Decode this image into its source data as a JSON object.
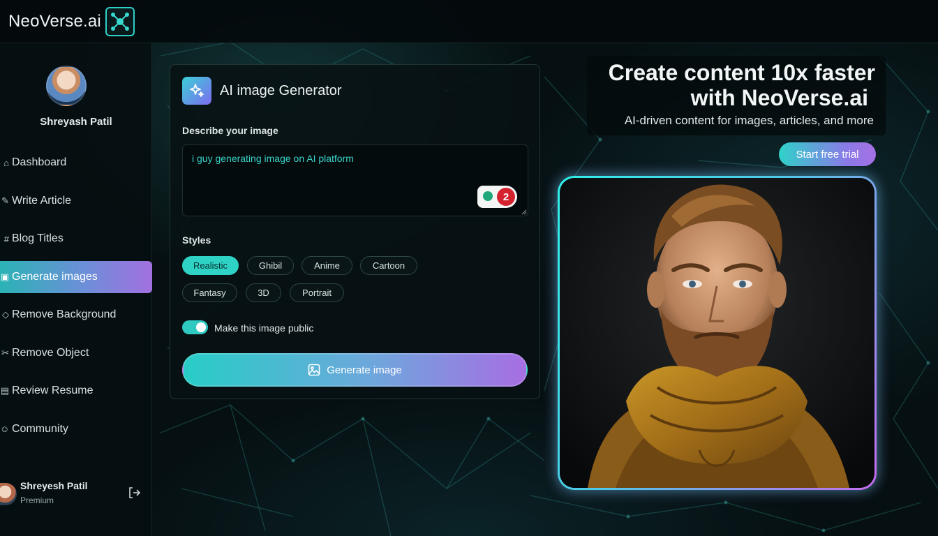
{
  "app": {
    "brand": "NeoVerse.ai",
    "logo_icon": "network-nodes-icon"
  },
  "user": {
    "name": "Shreyash Patil",
    "tier": "Premium"
  },
  "sidebar": {
    "items": [
      {
        "label": "Dashboard",
        "icon": "home-icon",
        "active": false
      },
      {
        "label": "Write Article",
        "icon": "pencil-icon",
        "active": false
      },
      {
        "label": "Blog Titles",
        "icon": "hash-icon",
        "active": false
      },
      {
        "label": "Generate images",
        "icon": "image-icon",
        "active": true
      },
      {
        "label": "Remove Background",
        "icon": "eraser-icon",
        "active": false
      },
      {
        "label": "Remove Object",
        "icon": "scissors-icon",
        "active": false
      },
      {
        "label": "Review Resume",
        "icon": "file-icon",
        "active": false
      },
      {
        "label": "Community",
        "icon": "users-icon",
        "active": false
      }
    ],
    "footer": {
      "name": "Shreyesh Patil",
      "tier": "Premium"
    }
  },
  "generator": {
    "title": "AI image Generator",
    "describe_label": "Describe your image",
    "prompt_value": "i guy generating image on AI platform",
    "extension_badge_count": "2",
    "styles_label": "Styles",
    "styles": [
      "Realistic",
      "Ghibil",
      "Anime",
      "Cartoon",
      "Fantasy",
      "3D",
      "Portrait"
    ],
    "selected_style": "Realistic",
    "public_toggle_label": "Make this image public",
    "public_toggle_on": true,
    "generate_button": "Generate image"
  },
  "hero": {
    "headline_line1": "Create content 10x faster",
    "headline_line2": "with NeoVerse.ai",
    "subtitle": "AI-driven content for images, articles, and more",
    "cta": "Start free trial"
  },
  "colors": {
    "accent_teal": "#2fd3c6",
    "accent_purple": "#a76ee3",
    "badge_red": "#d4232f"
  }
}
